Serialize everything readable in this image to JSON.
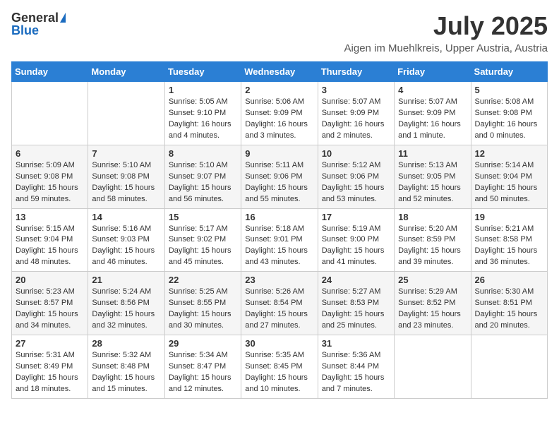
{
  "logo": {
    "general": "General",
    "blue": "Blue"
  },
  "title": "July 2025",
  "location": "Aigen im Muehlkreis, Upper Austria, Austria",
  "weekdays": [
    "Sunday",
    "Monday",
    "Tuesday",
    "Wednesday",
    "Thursday",
    "Friday",
    "Saturday"
  ],
  "weeks": [
    [
      null,
      null,
      {
        "day": 1,
        "sunrise": "5:05 AM",
        "sunset": "9:10 PM",
        "daylight": "16 hours and 4 minutes."
      },
      {
        "day": 2,
        "sunrise": "5:06 AM",
        "sunset": "9:09 PM",
        "daylight": "16 hours and 3 minutes."
      },
      {
        "day": 3,
        "sunrise": "5:07 AM",
        "sunset": "9:09 PM",
        "daylight": "16 hours and 2 minutes."
      },
      {
        "day": 4,
        "sunrise": "5:07 AM",
        "sunset": "9:09 PM",
        "daylight": "16 hours and 1 minute."
      },
      {
        "day": 5,
        "sunrise": "5:08 AM",
        "sunset": "9:08 PM",
        "daylight": "16 hours and 0 minutes."
      }
    ],
    [
      {
        "day": 6,
        "sunrise": "5:09 AM",
        "sunset": "9:08 PM",
        "daylight": "15 hours and 59 minutes."
      },
      {
        "day": 7,
        "sunrise": "5:10 AM",
        "sunset": "9:08 PM",
        "daylight": "15 hours and 58 minutes."
      },
      {
        "day": 8,
        "sunrise": "5:10 AM",
        "sunset": "9:07 PM",
        "daylight": "15 hours and 56 minutes."
      },
      {
        "day": 9,
        "sunrise": "5:11 AM",
        "sunset": "9:06 PM",
        "daylight": "15 hours and 55 minutes."
      },
      {
        "day": 10,
        "sunrise": "5:12 AM",
        "sunset": "9:06 PM",
        "daylight": "15 hours and 53 minutes."
      },
      {
        "day": 11,
        "sunrise": "5:13 AM",
        "sunset": "9:05 PM",
        "daylight": "15 hours and 52 minutes."
      },
      {
        "day": 12,
        "sunrise": "5:14 AM",
        "sunset": "9:04 PM",
        "daylight": "15 hours and 50 minutes."
      }
    ],
    [
      {
        "day": 13,
        "sunrise": "5:15 AM",
        "sunset": "9:04 PM",
        "daylight": "15 hours and 48 minutes."
      },
      {
        "day": 14,
        "sunrise": "5:16 AM",
        "sunset": "9:03 PM",
        "daylight": "15 hours and 46 minutes."
      },
      {
        "day": 15,
        "sunrise": "5:17 AM",
        "sunset": "9:02 PM",
        "daylight": "15 hours and 45 minutes."
      },
      {
        "day": 16,
        "sunrise": "5:18 AM",
        "sunset": "9:01 PM",
        "daylight": "15 hours and 43 minutes."
      },
      {
        "day": 17,
        "sunrise": "5:19 AM",
        "sunset": "9:00 PM",
        "daylight": "15 hours and 41 minutes."
      },
      {
        "day": 18,
        "sunrise": "5:20 AM",
        "sunset": "8:59 PM",
        "daylight": "15 hours and 39 minutes."
      },
      {
        "day": 19,
        "sunrise": "5:21 AM",
        "sunset": "8:58 PM",
        "daylight": "15 hours and 36 minutes."
      }
    ],
    [
      {
        "day": 20,
        "sunrise": "5:23 AM",
        "sunset": "8:57 PM",
        "daylight": "15 hours and 34 minutes."
      },
      {
        "day": 21,
        "sunrise": "5:24 AM",
        "sunset": "8:56 PM",
        "daylight": "15 hours and 32 minutes."
      },
      {
        "day": 22,
        "sunrise": "5:25 AM",
        "sunset": "8:55 PM",
        "daylight": "15 hours and 30 minutes."
      },
      {
        "day": 23,
        "sunrise": "5:26 AM",
        "sunset": "8:54 PM",
        "daylight": "15 hours and 27 minutes."
      },
      {
        "day": 24,
        "sunrise": "5:27 AM",
        "sunset": "8:53 PM",
        "daylight": "15 hours and 25 minutes."
      },
      {
        "day": 25,
        "sunrise": "5:29 AM",
        "sunset": "8:52 PM",
        "daylight": "15 hours and 23 minutes."
      },
      {
        "day": 26,
        "sunrise": "5:30 AM",
        "sunset": "8:51 PM",
        "daylight": "15 hours and 20 minutes."
      }
    ],
    [
      {
        "day": 27,
        "sunrise": "5:31 AM",
        "sunset": "8:49 PM",
        "daylight": "15 hours and 18 minutes."
      },
      {
        "day": 28,
        "sunrise": "5:32 AM",
        "sunset": "8:48 PM",
        "daylight": "15 hours and 15 minutes."
      },
      {
        "day": 29,
        "sunrise": "5:34 AM",
        "sunset": "8:47 PM",
        "daylight": "15 hours and 12 minutes."
      },
      {
        "day": 30,
        "sunrise": "5:35 AM",
        "sunset": "8:45 PM",
        "daylight": "15 hours and 10 minutes."
      },
      {
        "day": 31,
        "sunrise": "5:36 AM",
        "sunset": "8:44 PM",
        "daylight": "15 hours and 7 minutes."
      },
      null,
      null
    ]
  ]
}
